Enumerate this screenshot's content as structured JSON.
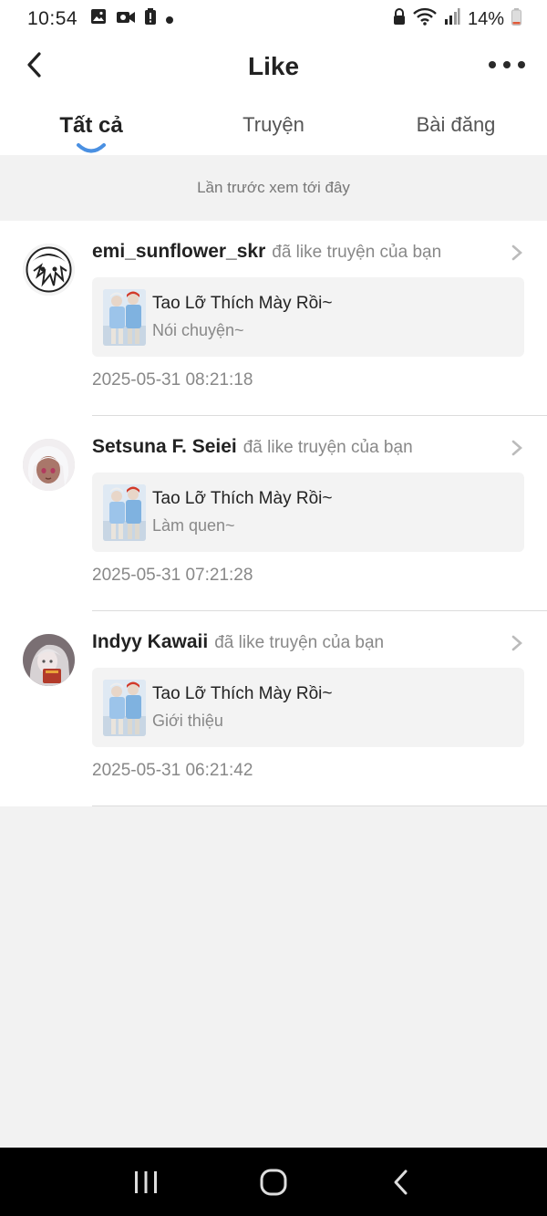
{
  "status_bar": {
    "time": "10:54",
    "battery": "14%",
    "left_icons": [
      "image-icon",
      "video-icon",
      "battery-alert-icon",
      "dot-icon"
    ],
    "right_icons": [
      "lock-icon",
      "wifi-icon",
      "signal-icon",
      "battery-icon"
    ]
  },
  "header": {
    "title": "Like",
    "back_icon": "chevron-left-icon",
    "more_icon": "more-dots-icon"
  },
  "tabs": [
    {
      "label": "Tất cả",
      "active": true
    },
    {
      "label": "Truyện",
      "active": false
    },
    {
      "label": "Bài đăng",
      "active": false
    }
  ],
  "accent_color": "#4a90e2",
  "last_seen": "Lần trước xem tới đây",
  "notifications": [
    {
      "username": "emi_sunflower_skr",
      "action": "đã like truyện của bạn",
      "story_title": "Tao Lỡ Thích Mày Rồi~",
      "chapter": "Nói chuyện~",
      "timestamp": "2025-05-31 08:21:18"
    },
    {
      "username": "Setsuna F. Seiei",
      "action": "đã like truyện của bạn",
      "story_title": "Tao Lỡ Thích Mày Rồi~",
      "chapter": "Làm quen~",
      "timestamp": "2025-05-31 07:21:28"
    },
    {
      "username": "Indyy Kawaii",
      "action": "đã like truyện của bạn",
      "story_title": "Tao Lỡ Thích Mày Rồi~",
      "chapter": "Giới thiệu",
      "timestamp": "2025-05-31 06:21:42"
    }
  ],
  "nav_bar": {
    "icons": [
      "recent-apps-icon",
      "home-icon",
      "back-icon"
    ]
  }
}
